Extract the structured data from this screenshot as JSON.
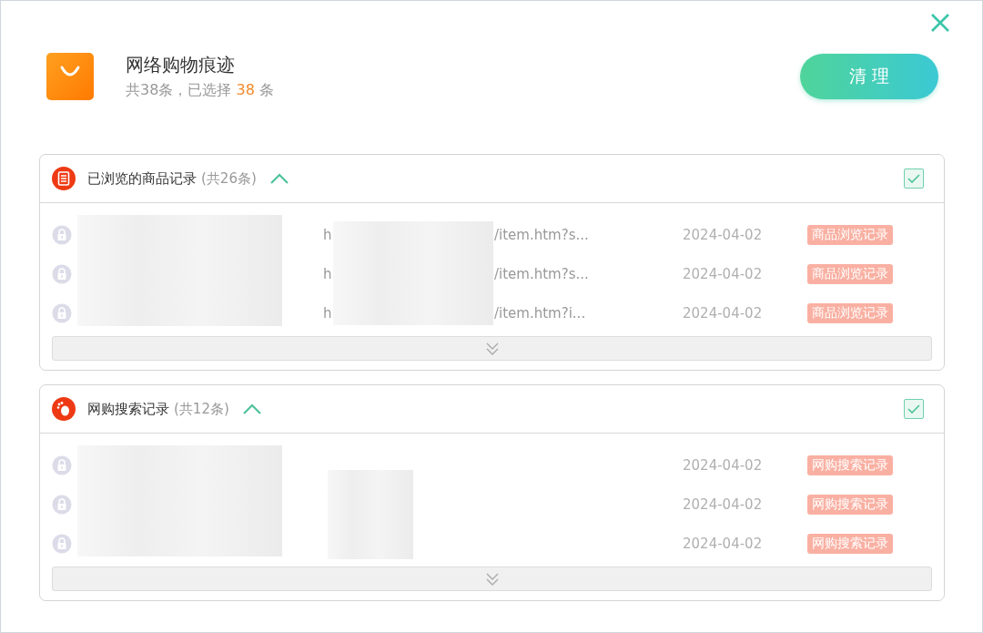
{
  "header": {
    "title": "网络购物痕迹",
    "summary_prefix": "共38条，已选择",
    "selected_count": "38",
    "summary_suffix": "条",
    "clean_button": "清 理"
  },
  "sections": [
    {
      "kind": "browse",
      "title": "已浏览的商品记录",
      "count": "(共26条)",
      "expanded": true,
      "checked": true,
      "rows": [
        {
          "url_start": "h",
          "url_end": "/item.htm?s...",
          "date": "2024-04-02",
          "tag": "商品浏览记录"
        },
        {
          "url_start": "h",
          "url_end": "/item.htm?s...",
          "date": "2024-04-02",
          "tag": "商品浏览记录"
        },
        {
          "url_start": "h",
          "url_end": "/item.htm?i...",
          "date": "2024-04-02",
          "tag": "商品浏览记录"
        }
      ]
    },
    {
      "kind": "search",
      "title": "网购搜索记录",
      "count": "(共12条)",
      "expanded": true,
      "checked": true,
      "rows": [
        {
          "date": "2024-04-02",
          "tag": "网购搜索记录"
        },
        {
          "date": "2024-04-02",
          "tag": "网购搜索记录"
        },
        {
          "date": "2024-04-02",
          "tag": "网购搜索记录"
        }
      ]
    }
  ]
}
